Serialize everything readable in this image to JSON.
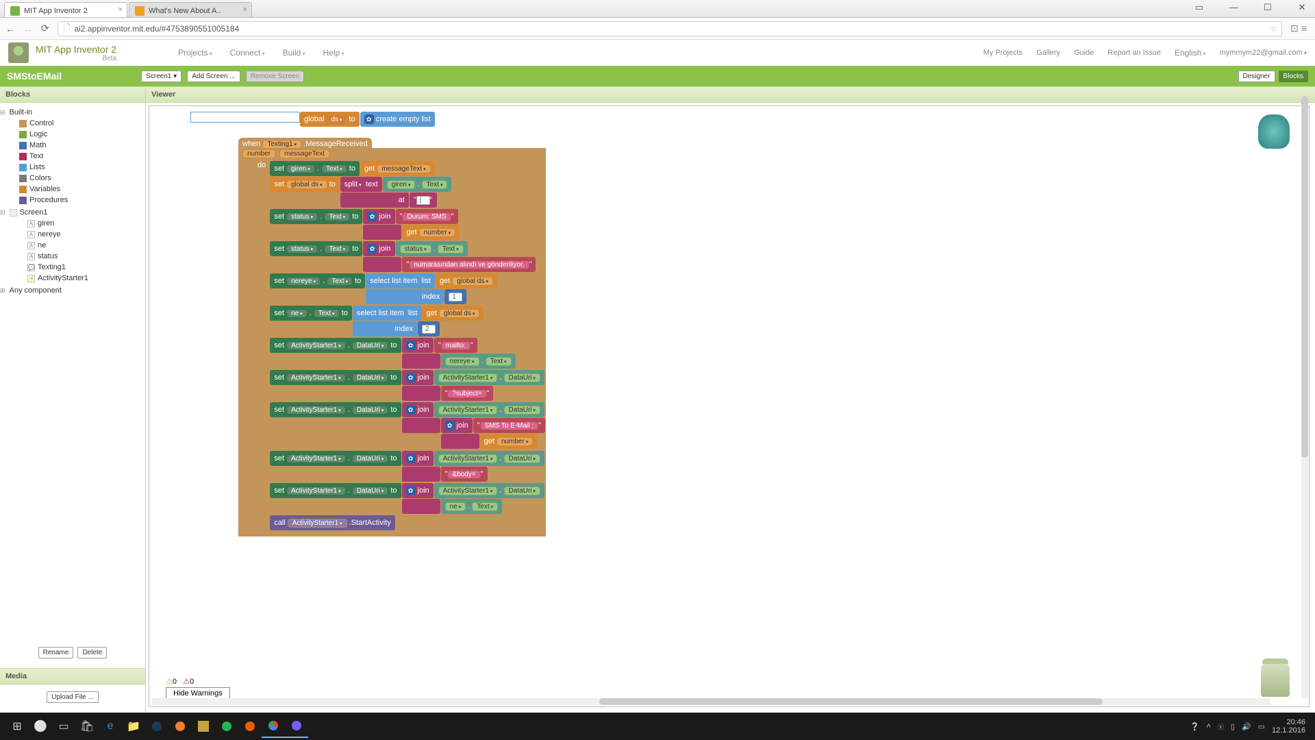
{
  "browser": {
    "tabs": [
      {
        "title": "MIT App Inventor 2",
        "active": true
      },
      {
        "title": "What's New About A..",
        "active": false
      }
    ],
    "url": "ai2.appinventor.mit.edu/#4753890551005184"
  },
  "app": {
    "title": "MIT App Inventor 2",
    "beta": "Beta",
    "menu": [
      "Projects",
      "Connect",
      "Build",
      "Help"
    ],
    "right": [
      "My Projects",
      "Gallery",
      "Guide",
      "Report an Issue",
      "English",
      "mymmym22@gmail.com"
    ]
  },
  "greenbar": {
    "project": "SMStoEMail",
    "screen_btn": "Screen1",
    "add_screen": "Add Screen ...",
    "remove_screen": "Remove Screen",
    "designer": "Designer",
    "blocks": "Blocks"
  },
  "panels": {
    "blocks_hdr": "Blocks",
    "viewer_hdr": "Viewer",
    "media_hdr": "Media",
    "rename": "Rename",
    "delete": "Delete",
    "upload": "Upload File ..."
  },
  "tree": {
    "builtin_label": "Built-in",
    "builtin": [
      {
        "label": "Control",
        "color": "#c49558"
      },
      {
        "label": "Logic",
        "color": "#77ab41"
      },
      {
        "label": "Math",
        "color": "#3f71b5"
      },
      {
        "label": "Text",
        "color": "#b12c5c"
      },
      {
        "label": "Lists",
        "color": "#49a6d4"
      },
      {
        "label": "Colors",
        "color": "#7b7b7b"
      },
      {
        "label": "Variables",
        "color": "#d88830"
      },
      {
        "label": "Procedures",
        "color": "#6b5b95"
      }
    ],
    "screen_label": "Screen1",
    "screen_items": [
      "giren",
      "nereye",
      "ne",
      "status",
      "Texting1",
      "ActivityStarter1"
    ],
    "any_component": "Any component"
  },
  "blocks": {
    "init_global": "global",
    "ds": "ds",
    "to": "to",
    "create_empty": "create empty list",
    "when": "when",
    "texting": "Texting1",
    "msg_received": ".MessageReceived",
    "number": "number",
    "messageText": "messageText",
    "do": "do",
    "set": "set",
    "get": "get",
    "call": "call",
    "giren": "giren",
    "text_prop": "Text",
    "global_ds": "global ds",
    "split": "split",
    "text_kw": "text",
    "at": "at",
    "pipe": "|",
    "status": "status",
    "join": "join",
    "durum_sms": "Durum: SMS ",
    "numarasindan": " numarasından alındı ve gönderiliyor.",
    "nereye": "nereye",
    "select_list": "select list item",
    "list": "list",
    "index": "index",
    "one": "1",
    "two": "2",
    "ne": "ne",
    "activity": "ActivityStarter1",
    "datauri": "DataUri",
    "mailto": "mailto:",
    "subject": "?subject=",
    "sms_to_email": "SMS To E-Mail : ",
    "body": "&body=",
    "start_activity": ".StartActivity"
  },
  "warnings": {
    "warn": "0",
    "err": "0",
    "hide": "Hide Warnings"
  },
  "taskbar": {
    "time": "20:46",
    "date": "12.1.2016"
  }
}
